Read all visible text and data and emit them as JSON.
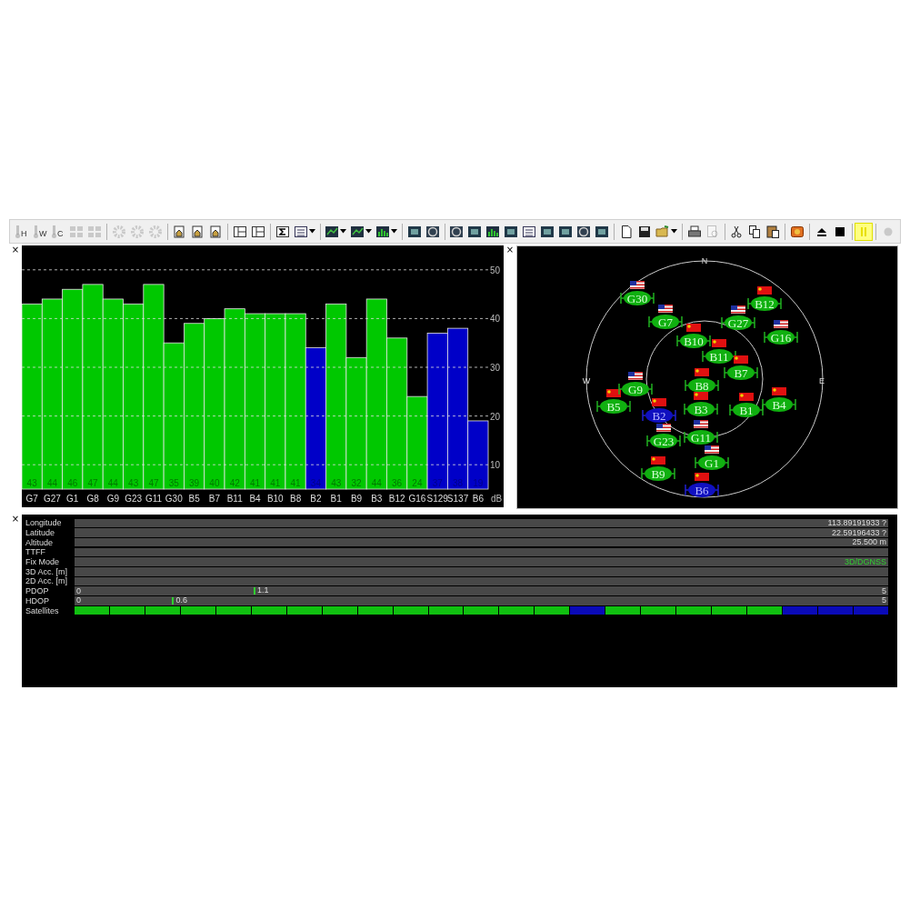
{
  "toolbar": {
    "groups": [
      [
        {
          "kind": "thermo",
          "label": "H",
          "dropdown": false,
          "disabled": true,
          "on": false
        },
        {
          "kind": "thermo",
          "label": "W",
          "dropdown": false,
          "disabled": true,
          "on": false
        },
        {
          "kind": "thermo",
          "label": "C",
          "dropdown": false,
          "disabled": true,
          "on": false
        },
        {
          "kind": "grid",
          "dropdown": false,
          "disabled": true,
          "on": false
        },
        {
          "kind": "grid",
          "dropdown": false,
          "disabled": true,
          "on": false
        }
      ],
      [
        {
          "kind": "gear",
          "dropdown": false,
          "disabled": true,
          "on": false
        },
        {
          "kind": "gear",
          "dropdown": false,
          "disabled": true,
          "on": false
        },
        {
          "kind": "gear",
          "dropdown": false,
          "disabled": true,
          "on": false
        }
      ],
      [
        {
          "kind": "doc",
          "dropdown": false,
          "disabled": false,
          "on": false
        },
        {
          "kind": "doc",
          "dropdown": false,
          "disabled": false,
          "on": false
        },
        {
          "kind": "doc",
          "dropdown": false,
          "disabled": false,
          "on": false
        }
      ],
      [
        {
          "kind": "panel",
          "dropdown": false,
          "disabled": false,
          "on": false
        },
        {
          "kind": "panel",
          "dropdown": false,
          "disabled": false,
          "on": false
        }
      ],
      [
        {
          "kind": "sigma",
          "dropdown": false,
          "disabled": false,
          "on": false
        },
        {
          "kind": "list",
          "dropdown": true,
          "disabled": false,
          "on": false
        }
      ],
      [
        {
          "kind": "chart",
          "dropdown": true,
          "disabled": false,
          "on": false
        },
        {
          "kind": "chart",
          "dropdown": true,
          "disabled": false,
          "on": false
        },
        {
          "kind": "bars",
          "dropdown": true,
          "disabled": false,
          "on": false
        }
      ],
      [
        {
          "kind": "view",
          "dropdown": false,
          "disabled": false,
          "on": false
        },
        {
          "kind": "globe",
          "dropdown": false,
          "disabled": false,
          "on": false
        }
      ],
      [
        {
          "kind": "globe",
          "dropdown": false,
          "disabled": false,
          "on": false
        },
        {
          "kind": "view",
          "dropdown": false,
          "disabled": false,
          "on": false
        },
        {
          "kind": "bars",
          "dropdown": false,
          "disabled": false,
          "on": false
        },
        {
          "kind": "view",
          "dropdown": false,
          "disabled": false,
          "on": false
        },
        {
          "kind": "list",
          "dropdown": false,
          "disabled": false,
          "on": false
        },
        {
          "kind": "view",
          "dropdown": false,
          "disabled": false,
          "on": false
        },
        {
          "kind": "view",
          "dropdown": false,
          "disabled": false,
          "on": false
        },
        {
          "kind": "globe",
          "dropdown": false,
          "disabled": false,
          "on": false
        },
        {
          "kind": "view",
          "dropdown": false,
          "disabled": false,
          "on": false
        }
      ],
      [
        {
          "kind": "file",
          "dropdown": false,
          "disabled": false,
          "on": false
        },
        {
          "kind": "save",
          "dropdown": false,
          "disabled": false,
          "on": false
        },
        {
          "kind": "open",
          "dropdown": true,
          "disabled": false,
          "on": false
        }
      ],
      [
        {
          "kind": "print",
          "dropdown": false,
          "disabled": false,
          "on": false
        },
        {
          "kind": "preview",
          "dropdown": false,
          "disabled": true,
          "on": false
        }
      ],
      [
        {
          "kind": "cut",
          "dropdown": false,
          "disabled": false,
          "on": false
        },
        {
          "kind": "copy",
          "dropdown": false,
          "disabled": false,
          "on": false
        },
        {
          "kind": "paste",
          "dropdown": false,
          "disabled": false,
          "on": false
        }
      ],
      [
        {
          "kind": "tool",
          "dropdown": false,
          "disabled": false,
          "on": false
        }
      ],
      [
        {
          "kind": "eject",
          "dropdown": false,
          "disabled": false,
          "on": false
        },
        {
          "kind": "stop",
          "dropdown": false,
          "disabled": false,
          "on": false
        }
      ],
      [
        {
          "kind": "pause",
          "dropdown": false,
          "disabled": false,
          "on": true
        }
      ],
      [
        {
          "kind": "record",
          "dropdown": false,
          "disabled": true,
          "on": false
        }
      ]
    ]
  },
  "signal_pane": {
    "close": "×",
    "chart_data": {
      "type": "bar",
      "ylabel": "dB",
      "categories": [
        "G7",
        "G27",
        "G1",
        "G8",
        "G9",
        "G23",
        "G11",
        "G30",
        "B5",
        "B7",
        "B11",
        "B4",
        "B10",
        "B8",
        "B2",
        "B1",
        "B9",
        "B3",
        "B12",
        "G16",
        "S129",
        "S137",
        "B6"
      ],
      "series": [
        {
          "color": "#00c800",
          "values": [
            43,
            44,
            46,
            47,
            44,
            43,
            47,
            35,
            39,
            40,
            42,
            41,
            41,
            41,
            null,
            43,
            32,
            44,
            36,
            24,
            null,
            null,
            null
          ]
        },
        {
          "color": "#0000c8",
          "values": [
            null,
            null,
            null,
            null,
            null,
            null,
            null,
            null,
            null,
            null,
            null,
            null,
            null,
            null,
            34,
            null,
            null,
            null,
            null,
            null,
            37,
            38,
            19
          ]
        }
      ],
      "ylim": [
        5,
        55
      ],
      "yticks": [
        10,
        20,
        30,
        40,
        50
      ],
      "grid": true,
      "data_labels": true
    }
  },
  "sky_pane": {
    "close": "×",
    "compass": [
      "N",
      "W",
      "E"
    ],
    "satellites": [
      {
        "label": "G30",
        "kind": "gps",
        "used": true
      },
      {
        "label": "G7",
        "kind": "gps",
        "used": true
      },
      {
        "label": "G27",
        "kind": "gps",
        "used": true
      },
      {
        "label": "B12",
        "kind": "beidou",
        "used": true
      },
      {
        "label": "G16",
        "kind": "gps",
        "used": true
      },
      {
        "label": "B10",
        "kind": "beidou",
        "used": true
      },
      {
        "label": "B11",
        "kind": "beidou",
        "used": true
      },
      {
        "label": "B7",
        "kind": "beidou",
        "used": true
      },
      {
        "label": "B8",
        "kind": "beidou",
        "used": true
      },
      {
        "label": "B5",
        "kind": "beidou",
        "used": true
      },
      {
        "label": "G9",
        "kind": "gps",
        "used": true
      },
      {
        "label": "B2",
        "kind": "beidou",
        "used": false
      },
      {
        "label": "B3",
        "kind": "beidou",
        "used": true
      },
      {
        "label": "G11",
        "kind": "gps",
        "used": true
      },
      {
        "label": "B1",
        "kind": "beidou",
        "used": true
      },
      {
        "label": "B4",
        "kind": "beidou",
        "used": true
      },
      {
        "label": "G23",
        "kind": "gps",
        "used": true
      },
      {
        "label": "G1",
        "kind": "gps",
        "used": true
      },
      {
        "label": "B9",
        "kind": "beidou",
        "used": true
      },
      {
        "label": "B6",
        "kind": "beidou",
        "used": false
      }
    ]
  },
  "info_pane": {
    "close": "×",
    "rows": [
      {
        "kind": "text",
        "label": "Longitude",
        "value": "113.89191933 ?"
      },
      {
        "kind": "text",
        "label": "Latitude",
        "value": "22.59196433 ?"
      },
      {
        "kind": "text",
        "label": "Altitude",
        "value": "25.500 m"
      },
      {
        "kind": "text",
        "label": "TTFF"
      },
      {
        "kind": "status",
        "label": "Fix Mode",
        "value": "3D/DGNSS"
      },
      {
        "kind": "text",
        "label": "3D Acc. [m]"
      },
      {
        "kind": "text",
        "label": "2D Acc. [m]"
      },
      {
        "kind": "gauge",
        "label": "PDOP",
        "min": "0",
        "max": "5",
        "reading": "1.1",
        "level": 0.22
      },
      {
        "kind": "gauge",
        "label": "HDOP",
        "min": "0",
        "max": "5",
        "reading": "0.6",
        "level": 0.12
      },
      {
        "kind": "segments",
        "label": "Satellites",
        "segments": [
          {
            "used": true
          },
          {
            "used": true
          },
          {
            "used": true
          },
          {
            "used": true
          },
          {
            "used": true
          },
          {
            "used": true
          },
          {
            "used": true
          },
          {
            "used": true
          },
          {
            "used": true
          },
          {
            "used": true
          },
          {
            "used": true
          },
          {
            "used": true
          },
          {
            "used": true
          },
          {
            "used": true
          },
          {
            "used": false
          },
          {
            "used": true
          },
          {
            "used": true
          },
          {
            "used": true
          },
          {
            "used": true
          },
          {
            "used": true
          },
          {
            "used": false
          },
          {
            "used": false
          },
          {
            "used": false
          }
        ]
      }
    ]
  }
}
